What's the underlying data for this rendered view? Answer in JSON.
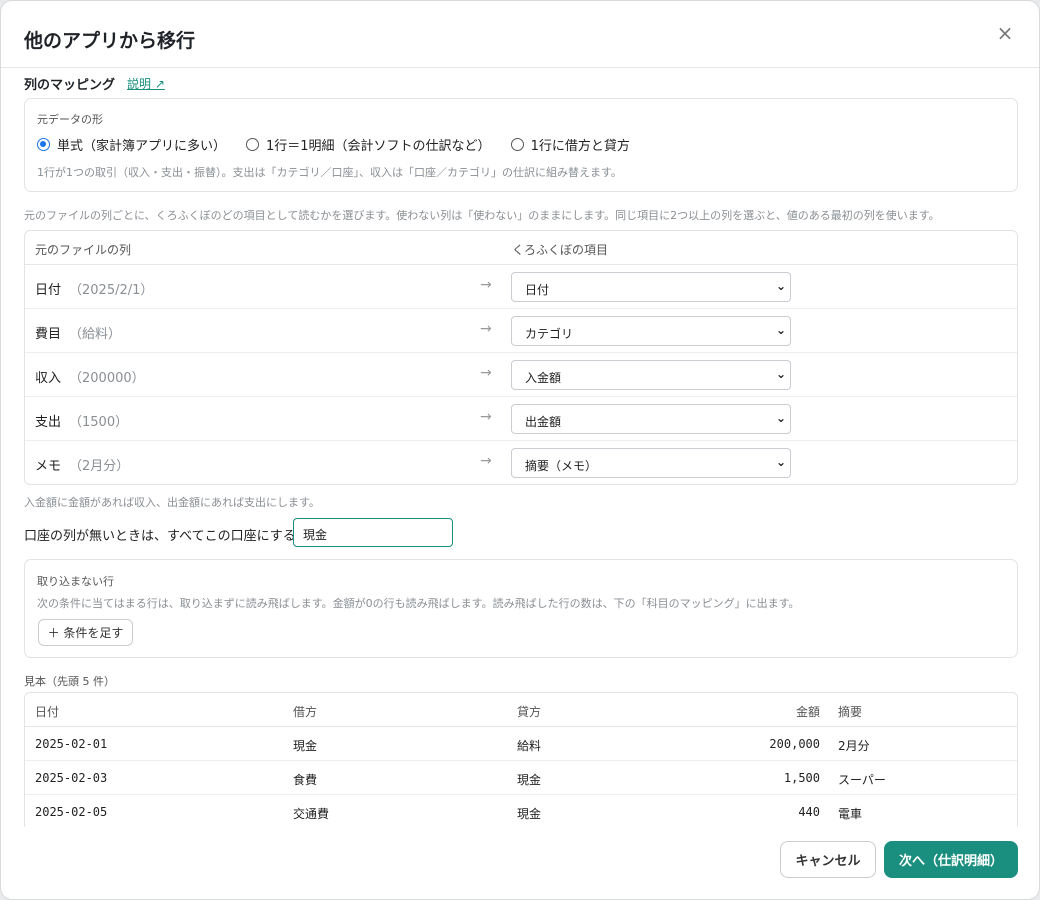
{
  "dialog": {
    "title": "他のアプリから移行",
    "close_symbol": "×"
  },
  "mapping": {
    "section_title": "列のマッピング",
    "help_link": "説明 ↗",
    "source_shape": {
      "label": "元データの形",
      "options": [
        {
          "label": "単式（家計簿アプリに多い）",
          "selected": true
        },
        {
          "label": "1行＝1明細（会計ソフトの仕訳など）",
          "selected": false
        },
        {
          "label": "1行に借方と貸方",
          "selected": false
        }
      ],
      "hint": "1行が1つの取引（収入・支出・振替）。支出は「カテゴリ／口座」、収入は「口座／カテゴリ」の仕訳に組み替えます。"
    },
    "instructions": "元のファイルの列ごとに、くろふくぼのどの項目として読むかを選びます。使わない列は「使わない」のままにします。同じ項目に2つ以上の列を選ぶと、値のある最初の列を使います。",
    "table": {
      "header_source": "元のファイルの列",
      "header_target": "くろふくぼの項目",
      "arrow": "→",
      "rows": [
        {
          "name": "日付",
          "sample": "（2025/2/1）",
          "target": "日付"
        },
        {
          "name": "費目",
          "sample": "（給料）",
          "target": "カテゴリ"
        },
        {
          "name": "収入",
          "sample": "（200000）",
          "target": "入金額"
        },
        {
          "name": "支出",
          "sample": "（1500）",
          "target": "出金額"
        },
        {
          "name": "メモ",
          "sample": "（2月分）",
          "target": "摘要（メモ）"
        }
      ]
    },
    "amount_note": "入金額に金額があれば収入、出金額にあれば支出にします。",
    "default_account_label": "口座の列が無いときは、すべてこの口座にする",
    "default_account_value": "現金"
  },
  "skip_rows": {
    "label": "取り込まない行",
    "hint": "次の条件に当てはまる行は、取り込まずに読み飛ばします。金額が0の行も読み飛ばします。読み飛ばした行の数は、下の「科目のマッピング」に出ます。",
    "add_button": "＋ 条件を足す"
  },
  "preview": {
    "label": "見本（先頭 5 件）",
    "headers": [
      "日付",
      "借方",
      "貸方",
      "金額",
      "摘要"
    ],
    "rows": [
      [
        "2025-02-01",
        "現金",
        "給料",
        "200,000",
        "2月分"
      ],
      [
        "2025-02-03",
        "食費",
        "現金",
        "1,500",
        "スーパー"
      ],
      [
        "2025-02-05",
        "交通費",
        "現金",
        "440",
        "電車"
      ],
      [
        "",
        "",
        "",
        "",
        ""
      ]
    ]
  },
  "footer": {
    "cancel": "キャンセル",
    "next": "次へ（仕訳明細）"
  },
  "colors": {
    "accent": "#1a8f7f",
    "radio": "#1a73e8"
  }
}
